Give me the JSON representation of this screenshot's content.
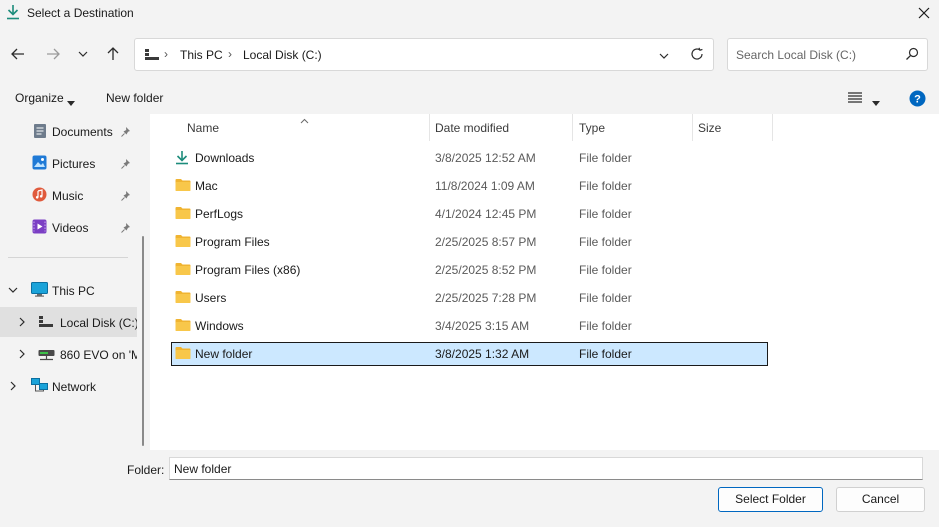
{
  "window": {
    "title": "Select a Destination",
    "title_icon": "download-arrow-icon",
    "close_icon": "close-icon"
  },
  "nav": {
    "back_icon": "arrow-left-icon",
    "forward_icon": "arrow-right-icon",
    "recent_icon": "chevron-down-icon",
    "up_icon": "arrow-up-icon",
    "address": {
      "segments": [
        "This PC",
        "Local Disk (C:)"
      ],
      "dropdown_icon": "chevron-down-icon",
      "refresh_icon": "refresh-icon"
    },
    "search": {
      "placeholder": "Search Local Disk (C:)",
      "icon": "search-icon"
    }
  },
  "toolbar": {
    "organize_label": "Organize",
    "new_folder_label": "New folder",
    "view_icon": "list-view-icon",
    "help_icon": "help-icon"
  },
  "sidebar": {
    "quick_access": [
      {
        "label": "Documents",
        "icon": "documents-icon",
        "pinned": true
      },
      {
        "label": "Pictures",
        "icon": "pictures-icon",
        "pinned": true
      },
      {
        "label": "Music",
        "icon": "music-icon",
        "pinned": true
      },
      {
        "label": "Videos",
        "icon": "videos-icon",
        "pinned": true
      }
    ],
    "tree": [
      {
        "label": "This PC",
        "icon": "monitor-icon",
        "expanded": true,
        "selected": false
      },
      {
        "label": "Local Disk (C:)",
        "icon": "drive-icon",
        "expanded": false,
        "selected": true
      },
      {
        "label": "860 EVO on 'M",
        "icon": "network-drive-icon",
        "expanded": false,
        "selected": false
      },
      {
        "label": "Network",
        "icon": "network-icon",
        "expanded": false,
        "selected": false
      }
    ]
  },
  "file_list": {
    "columns": [
      "Name",
      "Date modified",
      "Type",
      "Size"
    ],
    "rows": [
      {
        "name": "Downloads",
        "date": "3/8/2025 12:52 AM",
        "type": "File folder",
        "icon": "download-folder-icon"
      },
      {
        "name": "Mac",
        "date": "11/8/2024 1:09 AM",
        "type": "File folder",
        "icon": "folder-icon"
      },
      {
        "name": "PerfLogs",
        "date": "4/1/2024 12:45 PM",
        "type": "File folder",
        "icon": "folder-icon"
      },
      {
        "name": "Program Files",
        "date": "2/25/2025 8:57 PM",
        "type": "File folder",
        "icon": "folder-icon"
      },
      {
        "name": "Program Files (x86)",
        "date": "2/25/2025 8:52 PM",
        "type": "File folder",
        "icon": "folder-icon"
      },
      {
        "name": "Users",
        "date": "2/25/2025 7:28 PM",
        "type": "File folder",
        "icon": "folder-icon"
      },
      {
        "name": "Windows",
        "date": "3/4/2025 3:15 AM",
        "type": "File folder",
        "icon": "folder-icon"
      },
      {
        "name": "New folder",
        "date": "3/8/2025 1:32 AM",
        "type": "File folder",
        "icon": "folder-icon"
      }
    ],
    "selected_name": "New folder"
  },
  "footer": {
    "folder_label": "Folder:",
    "folder_value": "New folder",
    "select_label": "Select Folder",
    "cancel_label": "Cancel"
  },
  "colors": {
    "accent": "#0067c0",
    "selection": "#cce8ff",
    "folder": "#f8c74a",
    "chrome": "#f3f3f3"
  }
}
